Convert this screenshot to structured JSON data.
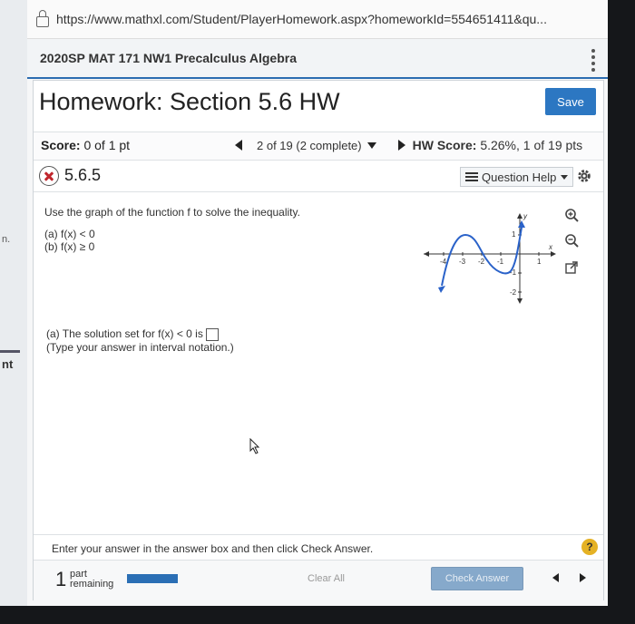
{
  "browser": {
    "url": "https://www.mathxl.com/Student/PlayerHomework.aspx?homeworkId=554651411&qu..."
  },
  "course": {
    "title": "2020SP MAT 171 NW1 Precalculus Algebra"
  },
  "left_fragments": {
    "frag1": "n.",
    "frag2": "nt"
  },
  "homework": {
    "title": "Homework: Section 5.6 HW",
    "save_label": "Save",
    "score_label": "Score:",
    "score_value": "0 of 1 pt",
    "nav_text": "2 of 19 (2 complete)",
    "hw_score_label": "HW Score:",
    "hw_score_value": "5.26%, 1 of 19 pts"
  },
  "question": {
    "number": "5.6.5",
    "help_label": "Question Help",
    "prompt": "Use the graph of the function f to solve the inequality.",
    "part_a": "(a) f(x) < 0",
    "part_b": "(b) f(x) ≥ 0",
    "answer_prompt": "(a) The solution set for f(x) < 0 is",
    "answer_hint": "(Type your answer in interval notation.)",
    "answer_value": ""
  },
  "graph": {
    "x_label": "x",
    "y_label": "y",
    "x_ticks": [
      "-4",
      "-3",
      "-2",
      "-1",
      "1"
    ],
    "y_ticks": [
      "1",
      "-1",
      "-2"
    ]
  },
  "footer": {
    "instruction": "Enter your answer in the answer box and then click Check Answer.",
    "help_symbol": "?",
    "parts_count": "1",
    "parts_word": "part",
    "remaining_word": "remaining",
    "clear_label": "Clear All",
    "check_label": "Check Answer"
  },
  "colors": {
    "accent": "#2c77c2",
    "curve": "#2a62c9",
    "error": "#c0262d",
    "help": "#e5b225"
  }
}
